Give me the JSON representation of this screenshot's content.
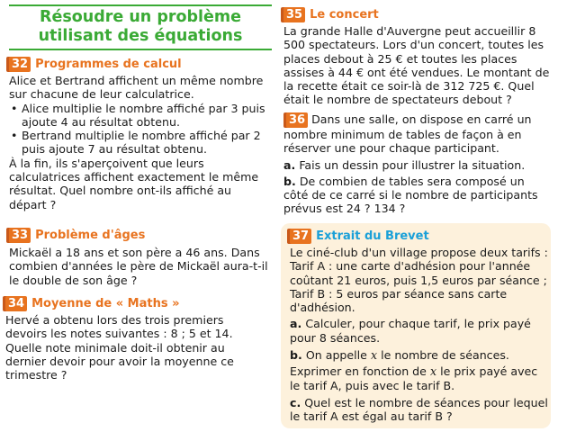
{
  "title": "Résoudre un problème utilisant des équations",
  "ex32": {
    "number": "32",
    "title": "Programmes de calcul",
    "intro": "Alice et Bertrand affichent un même nombre sur chacune de leur calculatrice.",
    "bullets": [
      "Alice multiplie le nombre affiché par 3 puis ajoute 4 au résultat obtenu.",
      "Bertrand multiplie le nombre affiché par 2 puis ajoute 7 au résultat obtenu."
    ],
    "question": "À la fin, ils s'aperçoivent que leurs calculatrices affichent exactement le même résultat. Quel nombre ont-ils affiché au départ ?"
  },
  "ex33": {
    "number": "33",
    "title": "Problème d'âges",
    "text": "Mickaël a 18 ans et son père a 46 ans. Dans combien d'années le père de Mickaël aura-t-il le double de son âge ?"
  },
  "ex34": {
    "number": "34",
    "title": "Moyenne de « Maths »",
    "text": "Hervé a obtenu lors des trois premiers devoirs les notes suivantes : 8 ; 5 et 14. Quelle note minimale doit-il obtenir au dernier devoir pour avoir la moyenne ce trimestre ?"
  },
  "ex35": {
    "number": "35",
    "title": "Le concert",
    "text": "La grande Halle d'Auvergne peut accueillir 8 500 spectateurs. Lors d'un concert, toutes les places debout à 25 € et toutes les places assises à 44 € ont été vendues. Le montant de la recette était ce soir-là de 312 725 €. Quel était le nombre de spectateurs debout ?"
  },
  "ex36": {
    "number": "36",
    "text_first": "Dans une salle, on dispose en carré",
    "text_rest": "un nombre minimum de tables de façon à en réserver une pour chaque participant.",
    "a_label": "a.",
    "a_text": "Fais un dessin pour illustrer la situation.",
    "b_label": "b.",
    "b_text": "De combien de tables sera composé un côté de ce carré si le nombre de participants prévus est 24 ? 134 ?"
  },
  "ex37": {
    "number": "37",
    "title": "Extrait du Brevet",
    "intro": "Le ciné-club d'un village propose deux tarifs :",
    "tarif_a": "Tarif A : une carte d'adhésion pour l'année coûtant 21 euros, puis 1,5 euros par séance ;",
    "tarif_b": "Tarif B : 5 euros par séance sans carte d'adhésion.",
    "a_label": "a.",
    "a_text": "Calculer, pour chaque tarif, le prix payé pour 8 séances.",
    "b_label": "b.",
    "b_text_1": "On appelle",
    "var": "x",
    "b_text_2": "le nombre de séances.",
    "b_text_3": "Exprimer en fonction de",
    "b_text_4": "le prix payé avec le tarif A, puis avec le tarif B.",
    "c_label": "c.",
    "c_text": "Quel est le nombre de séances pour lequel le tarif A est égal au tarif B ?"
  },
  "colors": {
    "green": "#3aaa35",
    "orange": "#e8731f",
    "blue": "#1aa0d8",
    "cream": "#fdf1dc"
  }
}
